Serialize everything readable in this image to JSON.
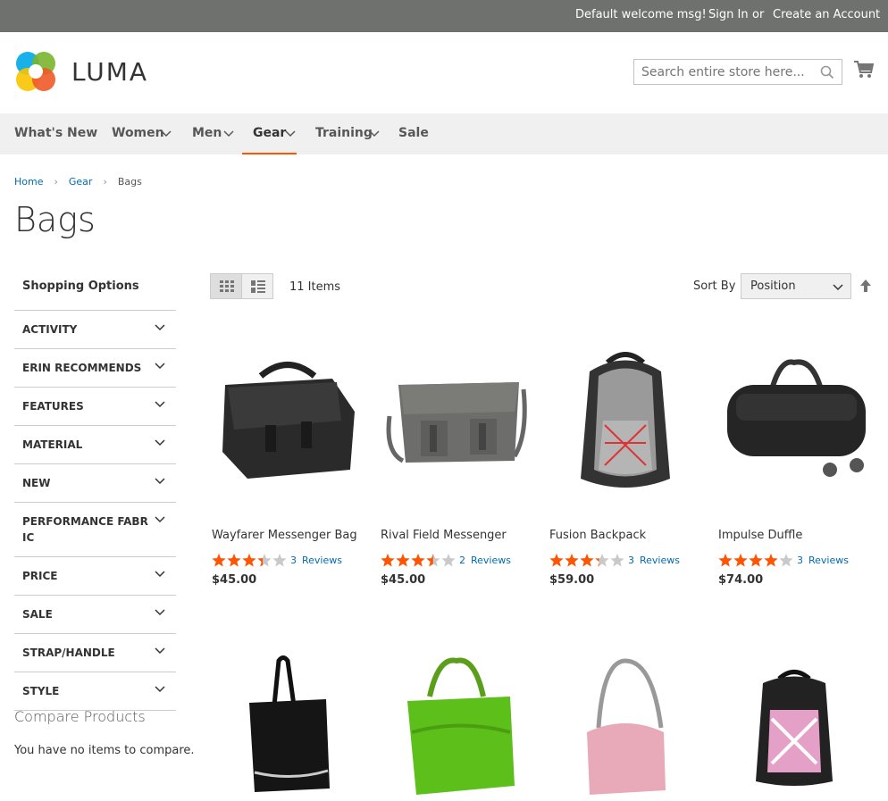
{
  "header": {
    "welcome": "Default welcome msg!",
    "sign_in": "Sign In",
    "or": "or",
    "create_account": "Create an Account",
    "logo_text": "LUMA",
    "search_placeholder": "Search entire store here..."
  },
  "nav": {
    "items": [
      {
        "label": "What's New"
      },
      {
        "label": "Women"
      },
      {
        "label": "Men"
      },
      {
        "label": "Gear"
      },
      {
        "label": "Training"
      },
      {
        "label": "Sale"
      }
    ]
  },
  "breadcrumb": {
    "home": "Home",
    "gear": "Gear",
    "current": "Bags"
  },
  "page_title": "Bags",
  "sidebar": {
    "title": "Shopping Options",
    "filters": [
      "ACTIVITY",
      "ERIN RECOMMENDS",
      "FEATURES",
      "MATERIAL",
      "NEW",
      "PERFORMANCE FABR IC",
      "PRICE",
      "SALE",
      "STRAP/HANDLE",
      "STYLE"
    ],
    "compare_title": "Compare Products",
    "compare_empty": "You have no items to compare."
  },
  "toolbar": {
    "items_count": "11 Items",
    "sort_label": "Sort By",
    "sort_value": "Position"
  },
  "products": [
    {
      "name": "Wayfarer Messenger Bag",
      "rating": 3.4,
      "reviews_count": "3",
      "reviews_label": "Reviews",
      "price": "$45.00"
    },
    {
      "name": "Rival Field Messenger",
      "rating": 3.5,
      "reviews_count": "2",
      "reviews_label": "Reviews",
      "price": "$45.00"
    },
    {
      "name": "Fusion Backpack",
      "rating": 3.3,
      "reviews_count": "3",
      "reviews_label": "Reviews",
      "price": "$59.00"
    },
    {
      "name": "Impulse Duffle",
      "rating": 4,
      "reviews_count": "3",
      "reviews_label": "Reviews",
      "price": "$74.00"
    }
  ],
  "colors": {
    "accent": "#ff5501",
    "link": "#006bb4",
    "star": "#ff5501",
    "topbar": "#6e716e",
    "nav_bg": "#f0f0f0"
  }
}
